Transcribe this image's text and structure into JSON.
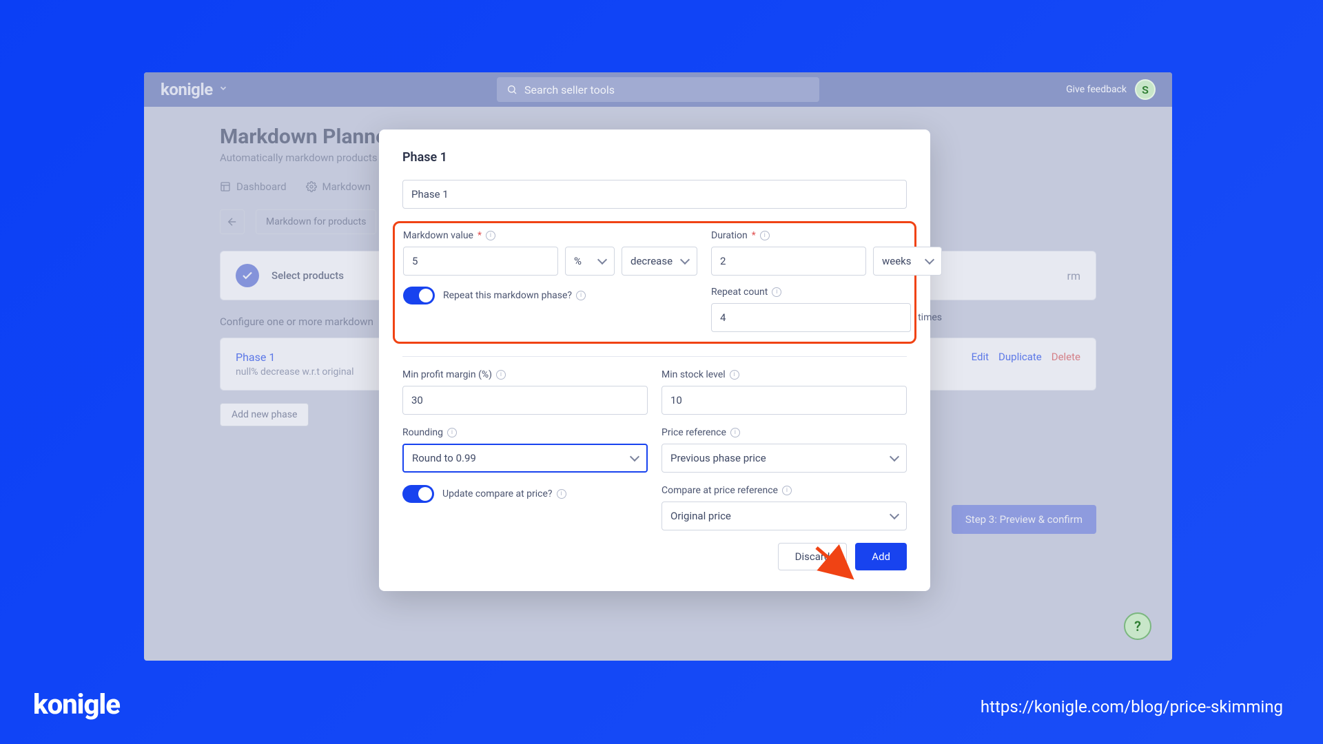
{
  "brand": "konigle",
  "topbar": {
    "search_placeholder": "Search seller tools",
    "feedback": "Give feedback",
    "avatar_initial": "S"
  },
  "page": {
    "title": "Markdown Planner",
    "subtitle": "Automatically markdown products",
    "tabs": {
      "dashboard": "Dashboard",
      "rules": "Markdown"
    },
    "breadcrumb": "Markdown for products",
    "step1": "Select products",
    "configure": "Configure one or more markdown",
    "phase_card": {
      "title": "Phase 1",
      "sub": "null% decrease w.r.t original",
      "edit": "Edit",
      "duplicate": "Duplicate",
      "delete": "Delete"
    },
    "add_phase": "Add new phase",
    "step3": "Step 3: Preview & confirm"
  },
  "modal": {
    "title": "Phase 1",
    "name_value": "Phase 1",
    "markdown_value_label": "Markdown value",
    "markdown_value": "5",
    "unit": "%",
    "direction": "decrease",
    "duration_label": "Duration",
    "duration_value": "2",
    "duration_unit": "weeks",
    "repeat_toggle": "Repeat this markdown phase?",
    "repeat_count_label": "Repeat count",
    "repeat_count": "4",
    "times": "times",
    "min_margin_label": "Min profit margin (%)",
    "min_margin": "30",
    "min_stock_label": "Min stock level",
    "min_stock": "10",
    "rounding_label": "Rounding",
    "rounding": "Round to 0.99",
    "price_ref_label": "Price reference",
    "price_ref": "Previous phase price",
    "update_cap": "Update compare at price?",
    "cap_ref_label": "Compare at price reference",
    "cap_ref": "Original price",
    "discard": "Discard",
    "add": "Add"
  },
  "footer_url": "https://konigle.com/blog/price-skimming",
  "help": "?"
}
